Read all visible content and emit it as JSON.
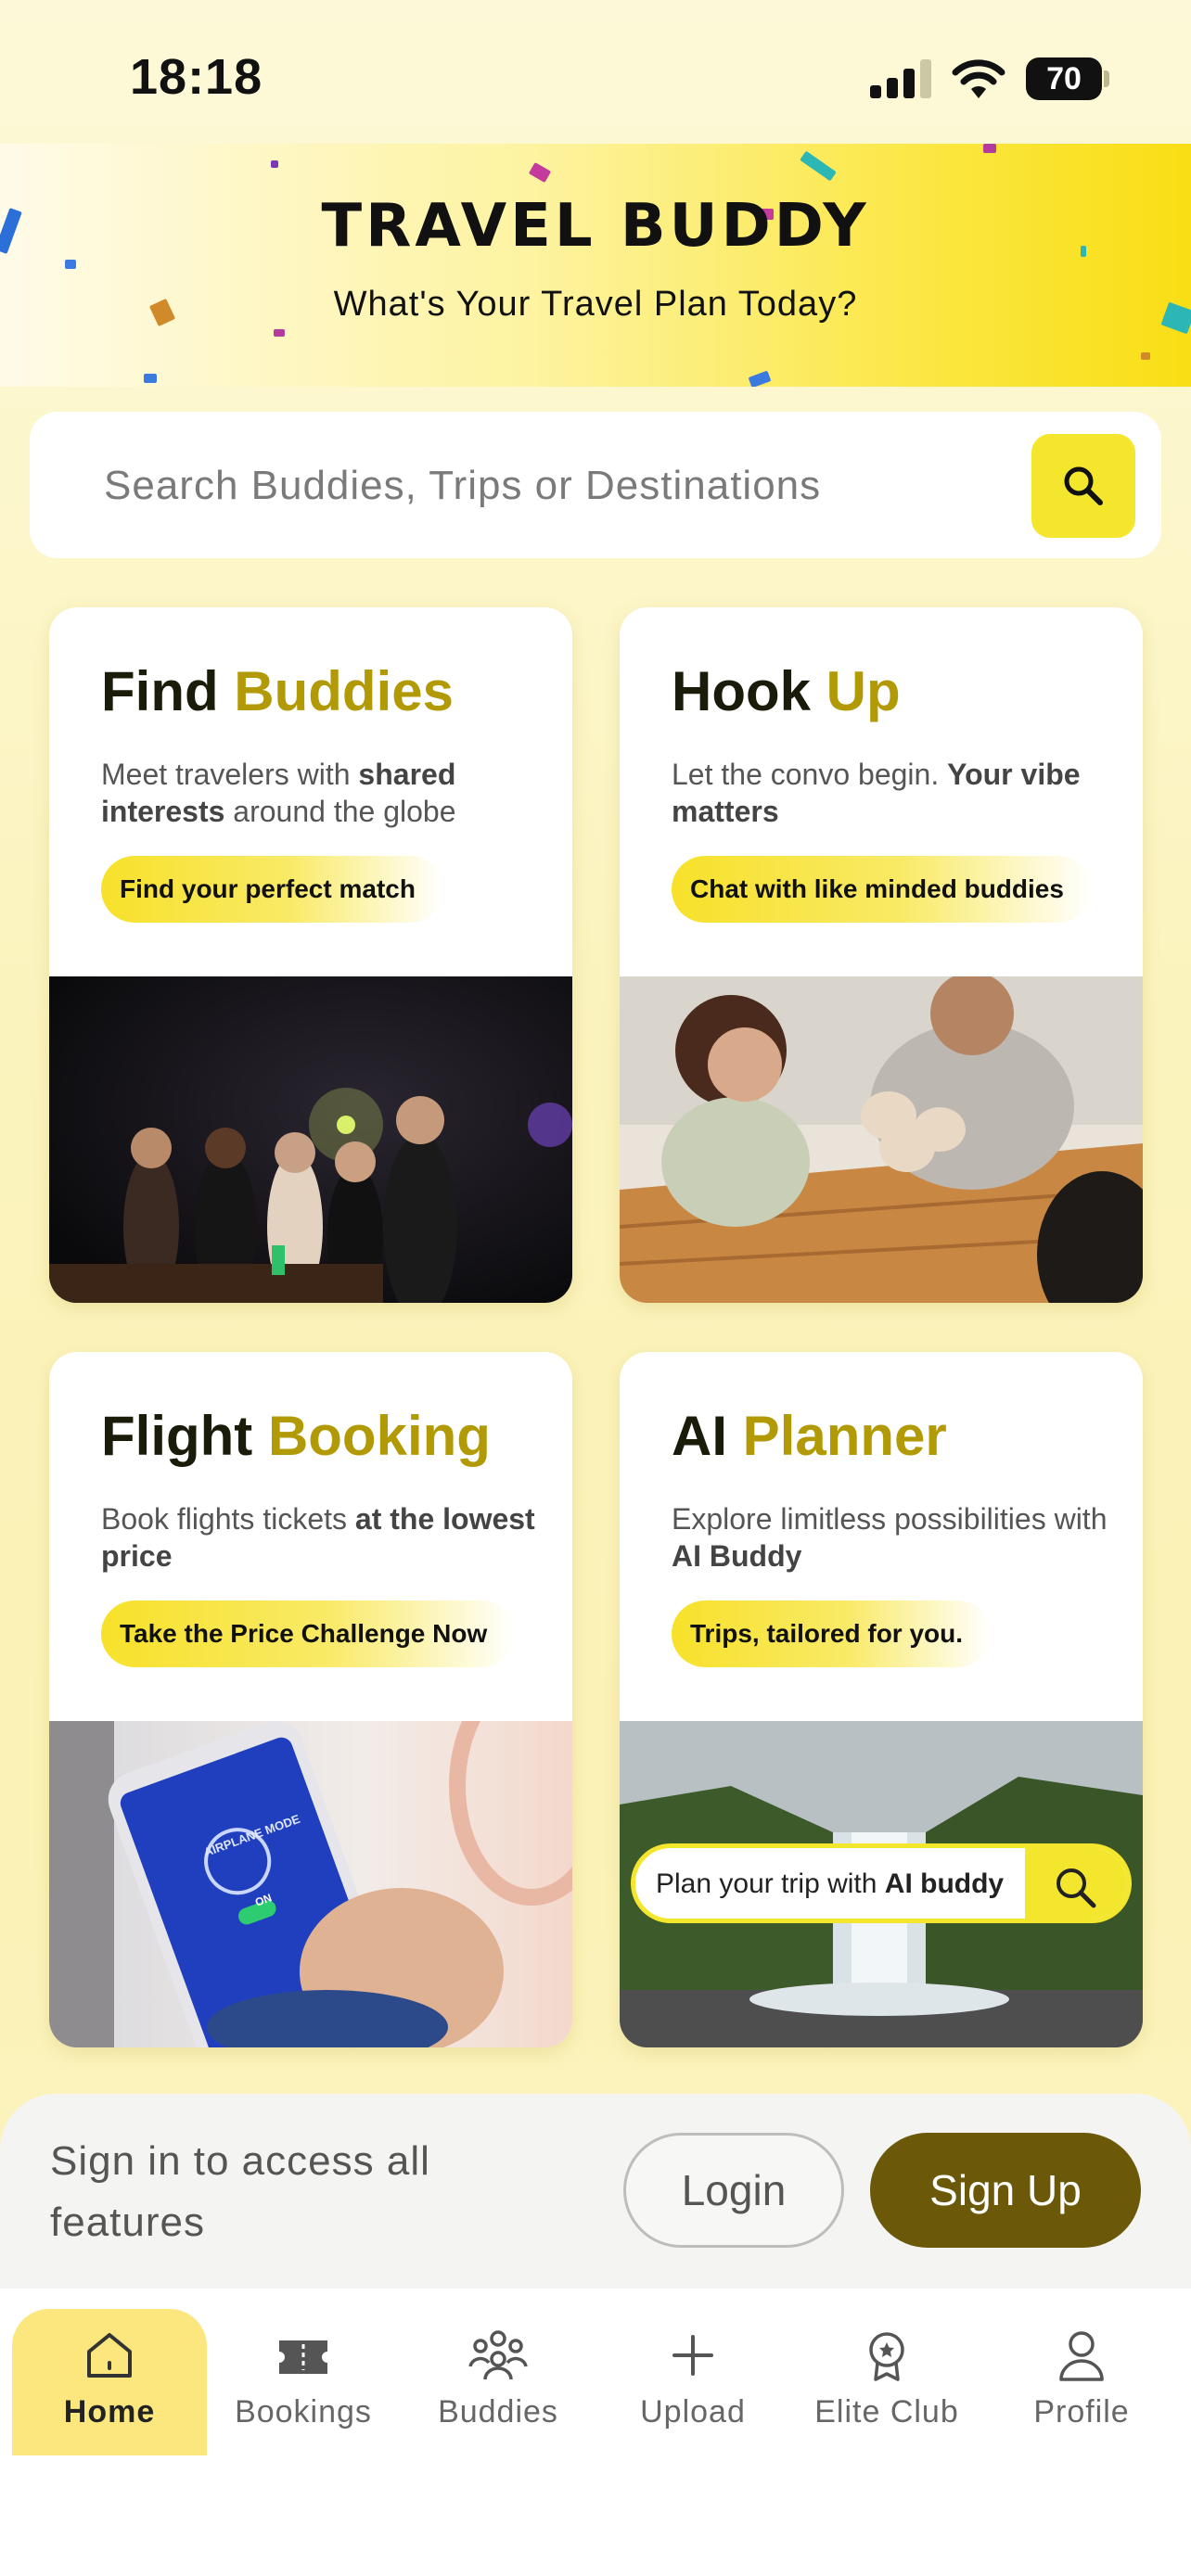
{
  "status_bar": {
    "time": "18:18",
    "battery": "70"
  },
  "banner": {
    "title": "TRAVEL BUDDY",
    "subtitle": "What's Your Travel Plan Today?"
  },
  "search": {
    "placeholder": "Search Buddies, Trips or Destinations",
    "icon": "search-icon"
  },
  "cards": [
    {
      "title_a": "Find",
      "title_b": "Buddies",
      "desc_plain": "Meet travelers with ",
      "desc_bold": "shared interests",
      "desc_tail": " around the globe",
      "pill": "Find your perfect match"
    },
    {
      "title_a": "Hook",
      "title_b": "Up",
      "desc_plain": "Let the convo begin. ",
      "desc_bold": "Your vibe matters",
      "desc_tail": "",
      "pill": "Chat with like minded buddies"
    },
    {
      "title_a": "Flight",
      "title_b": "Booking",
      "desc_plain": "Book flights tickets ",
      "desc_bold": "at the lowest price",
      "desc_tail": "",
      "pill": "Take the Price Challenge Now"
    },
    {
      "title_a": "AI",
      "title_b": "Planner",
      "desc_plain": "Explore limitless possibilities with ",
      "desc_bold": "AI Buddy",
      "desc_tail": "",
      "pill": "Trips, tailored for you."
    }
  ],
  "ai_image": {
    "plan_text": "Plan your trip with ",
    "plan_bold": "AI buddy"
  },
  "phone_image": {
    "screen_text": "AIRPLANE MODE",
    "toggle_text": "ON"
  },
  "signin": {
    "text": "Sign in to access all features",
    "login": "Login",
    "signup": "Sign Up"
  },
  "nav": [
    {
      "label": "Home",
      "icon": "home-icon",
      "active": true
    },
    {
      "label": "Bookings",
      "icon": "ticket-icon",
      "active": false
    },
    {
      "label": "Buddies",
      "icon": "group-icon",
      "active": false
    },
    {
      "label": "Upload",
      "icon": "plus-icon",
      "active": false
    },
    {
      "label": "Elite Club",
      "icon": "badge-icon",
      "active": false
    },
    {
      "label": "Profile",
      "icon": "user-icon",
      "active": false
    }
  ],
  "colors": {
    "accent_yellow": "#f3e62c",
    "brand_olive": "#6b5808",
    "title_gold": "#b29a06"
  }
}
